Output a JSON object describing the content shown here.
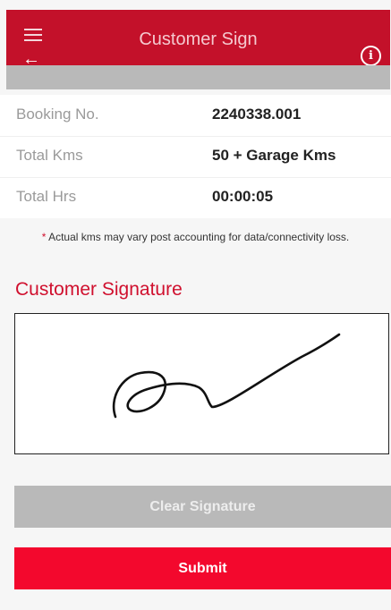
{
  "header": {
    "title": "Customer Sign",
    "menu_icon": "hamburger-menu-icon",
    "back_icon": "arrow-left-icon",
    "info_icon": "info-circle-icon",
    "info_glyph": "i",
    "background_color": "#c3112a"
  },
  "booking": {
    "rows": [
      {
        "label": "Booking No.",
        "value": "2240338.001"
      },
      {
        "label": "Total Kms",
        "value": "50 + Garage Kms"
      },
      {
        "label": "Total Hrs",
        "value": "00:00:05"
      }
    ]
  },
  "note": {
    "asterisk": "*",
    "text": " Actual kms may vary post accounting for data/connectivity loss."
  },
  "signature": {
    "heading": "Customer Signature"
  },
  "buttons": {
    "clear_label": "Clear Signature",
    "submit_label": "Submit",
    "submit_color": "#f3082d",
    "clear_color": "#b9b9b9"
  }
}
